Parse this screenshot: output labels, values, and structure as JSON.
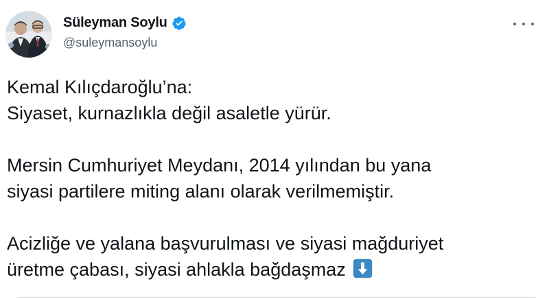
{
  "author": {
    "display_name": "Süleyman Soylu",
    "handle": "@suleymansoylu",
    "verified": true,
    "avatar_icon": "profile-photo"
  },
  "menu_icon": "more-horizontal-icon",
  "tweet": {
    "paragraphs": [
      {
        "lines": [
          "Kemal Kılıçdaroğlu’na:",
          "Siyaset, kurnazlıkla değil asaletle yürür."
        ]
      },
      {
        "lines": [
          "Mersin Cumhuriyet Meydanı, 2014 yılından bu yana",
          "siyasi partilere miting alanı olarak verilmemiştir."
        ]
      },
      {
        "lines": [
          "Acizliğe ve yalana başvurulması ve siyasi mağduriyet",
          "üretme çabası, siyasi ahlakla bağdaşmaz"
        ]
      }
    ],
    "trailing_emoji": "down-arrow-emoji"
  },
  "colors": {
    "text": "#0f1419",
    "secondary": "#536471",
    "verified_blue": "#1d9bf0",
    "emoji_blue": "#3b88c3",
    "divider": "#cfd9de"
  }
}
